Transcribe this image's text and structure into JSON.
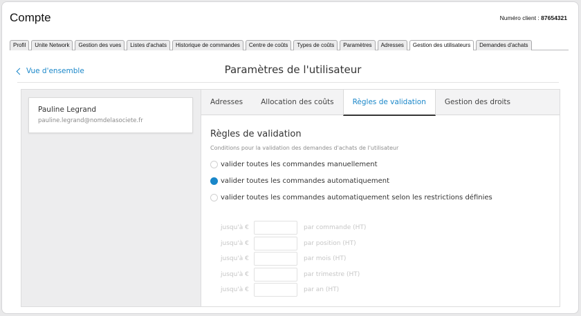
{
  "header": {
    "title": "Compte",
    "client_label": "Numéro client :",
    "client_number": "87654321"
  },
  "main_tabs": [
    {
      "label": "Profil"
    },
    {
      "label": "Unite Network"
    },
    {
      "label": "Gestion des vues"
    },
    {
      "label": "Listes d'achats"
    },
    {
      "label": "Historique de commandes"
    },
    {
      "label": "Centre de coûts"
    },
    {
      "label": "Types de coûts"
    },
    {
      "label": "Paramètres"
    },
    {
      "label": "Adresses"
    },
    {
      "label": "Gestion des utilisateurs",
      "active": true
    },
    {
      "label": "Demandes d'achats"
    }
  ],
  "nav": {
    "back_label": "Vue d'ensemble",
    "section_title": "Paramètres de l'utilisateur"
  },
  "user": {
    "name": "Pauline Legrand",
    "email": "pauline.legrand@nomdelasociete.fr"
  },
  "sub_tabs": [
    {
      "label": "Adresses"
    },
    {
      "label": "Allocation des coûts"
    },
    {
      "label": "Règles de validation",
      "active": true
    },
    {
      "label": "Gestion des droits"
    }
  ],
  "validation": {
    "title": "Règles de validation",
    "description": "Conditions pour la validation des demandes d'achats de l'utilisateur",
    "options": [
      {
        "label": "valider toutes les commandes manuellement",
        "checked": false
      },
      {
        "label": "valider toutes les commandes automatiquement",
        "checked": true
      },
      {
        "label": "valider toutes les commandes automatiquement selon les restrictions définies",
        "checked": false
      }
    ],
    "limits": [
      {
        "prefix": "jusqu'à €",
        "value": "",
        "suffix": "par commande (HT)"
      },
      {
        "prefix": "jusqu'à €",
        "value": "",
        "suffix": "par position (HT)"
      },
      {
        "prefix": "jusqu'à €",
        "value": "",
        "suffix": "par mois (HT)"
      },
      {
        "prefix": "jusqu'à €",
        "value": "",
        "suffix": "par trimestre (HT)"
      },
      {
        "prefix": "jusqu'à €",
        "value": "",
        "suffix": "par an (HT)"
      }
    ]
  },
  "colors": {
    "accent": "#1a87c9",
    "disabled_text": "#c6c6c6"
  },
  "icons": {
    "back": "chevron-left-icon",
    "radio_checked": "radio-checked-icon",
    "radio_unchecked": "radio-unchecked-icon"
  }
}
